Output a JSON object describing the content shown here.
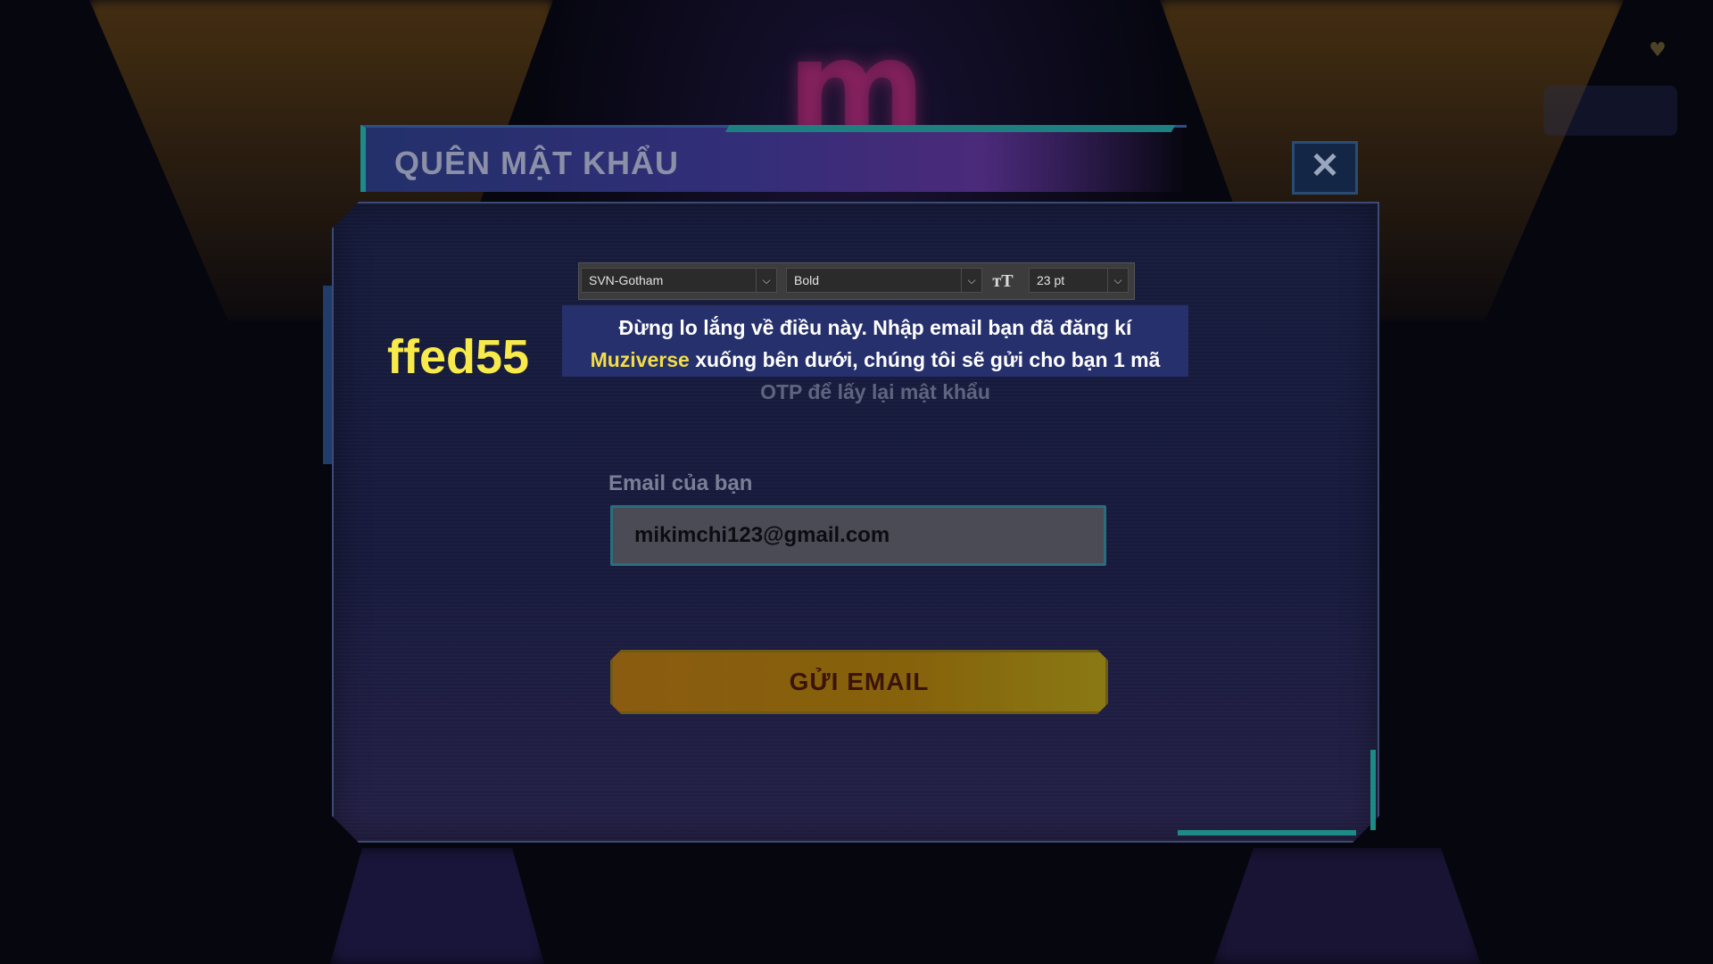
{
  "dialog": {
    "title": "QUÊN MẬT KHẨU",
    "close_icon": "close-icon",
    "close_glyph": "✕"
  },
  "background": {
    "logo_letter": "m"
  },
  "toolbar": {
    "font_family": "SVN-Gotham",
    "font_style": "Bold",
    "font_size": "23 pt",
    "size_icon": "text-size-icon",
    "size_glyph": "ᴛT",
    "dropdown_glyph": "⌵"
  },
  "side_code": "ffed55",
  "description": {
    "line1": "Đừng lo lắng về điều này. Nhập email bạn đã đăng kí",
    "line2_highlight": "Muziverse",
    "line2_rest": " xuống bên dưới, chúng tôi sẽ gửi cho bạn 1 mã",
    "line3": "OTP để lấy lại mật khẩu",
    "highlight_color": "#f3dd45"
  },
  "form": {
    "email_label": "Email của bạn",
    "email_value": "mikimchi123@gmail.com",
    "submit_label": "GỬI EMAIL"
  }
}
